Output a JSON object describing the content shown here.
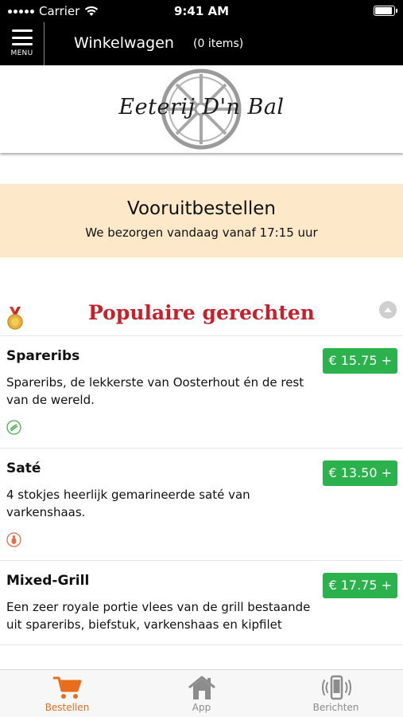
{
  "status_bar": {
    "carrier": "Carrier",
    "time": "9:41 AM"
  },
  "header": {
    "menu_label": "MENU",
    "title": "Winkelwagen",
    "cart_count": "(0 items)"
  },
  "logo": {
    "text": "Eeterij D'n Bal"
  },
  "banner": {
    "title": "Vooruitbestellen",
    "subtitle": "We bezorgen vandaag vanaf 17:15 uur"
  },
  "section": {
    "title": "Populaire gerechten"
  },
  "dishes": [
    {
      "name": "Spareribs",
      "description": "Spareribs, de lekkerste van Oosterhout én de rest van de wereld.",
      "price": "€ 15.75 +",
      "icon": "spareribs-icon",
      "icon_color": "#4caf50"
    },
    {
      "name": "Saté",
      "description": "4 stokjes heerlijk gemarineerde saté van varkenshaas.",
      "price": "€ 13.50 +",
      "icon": "pig-icon",
      "icon_color": "#e0704a"
    },
    {
      "name": "Mixed-Grill",
      "description": "Een zeer royale portie vlees van de grill bestaande uit spareribs, biefstuk, varkenshaas en kipfilet",
      "price": "€ 17.75 +"
    }
  ],
  "tabs": [
    {
      "label": "Bestellen",
      "icon": "cart-icon",
      "active": true
    },
    {
      "label": "App",
      "icon": "home-icon",
      "active": false
    },
    {
      "label": "Berichten",
      "icon": "phone-vibrate-icon",
      "active": false
    }
  ],
  "colors": {
    "accent": "#e86d1d",
    "price_button": "#2bb24c",
    "section_title": "#c8202b",
    "banner_bg": "#fde9c9"
  }
}
